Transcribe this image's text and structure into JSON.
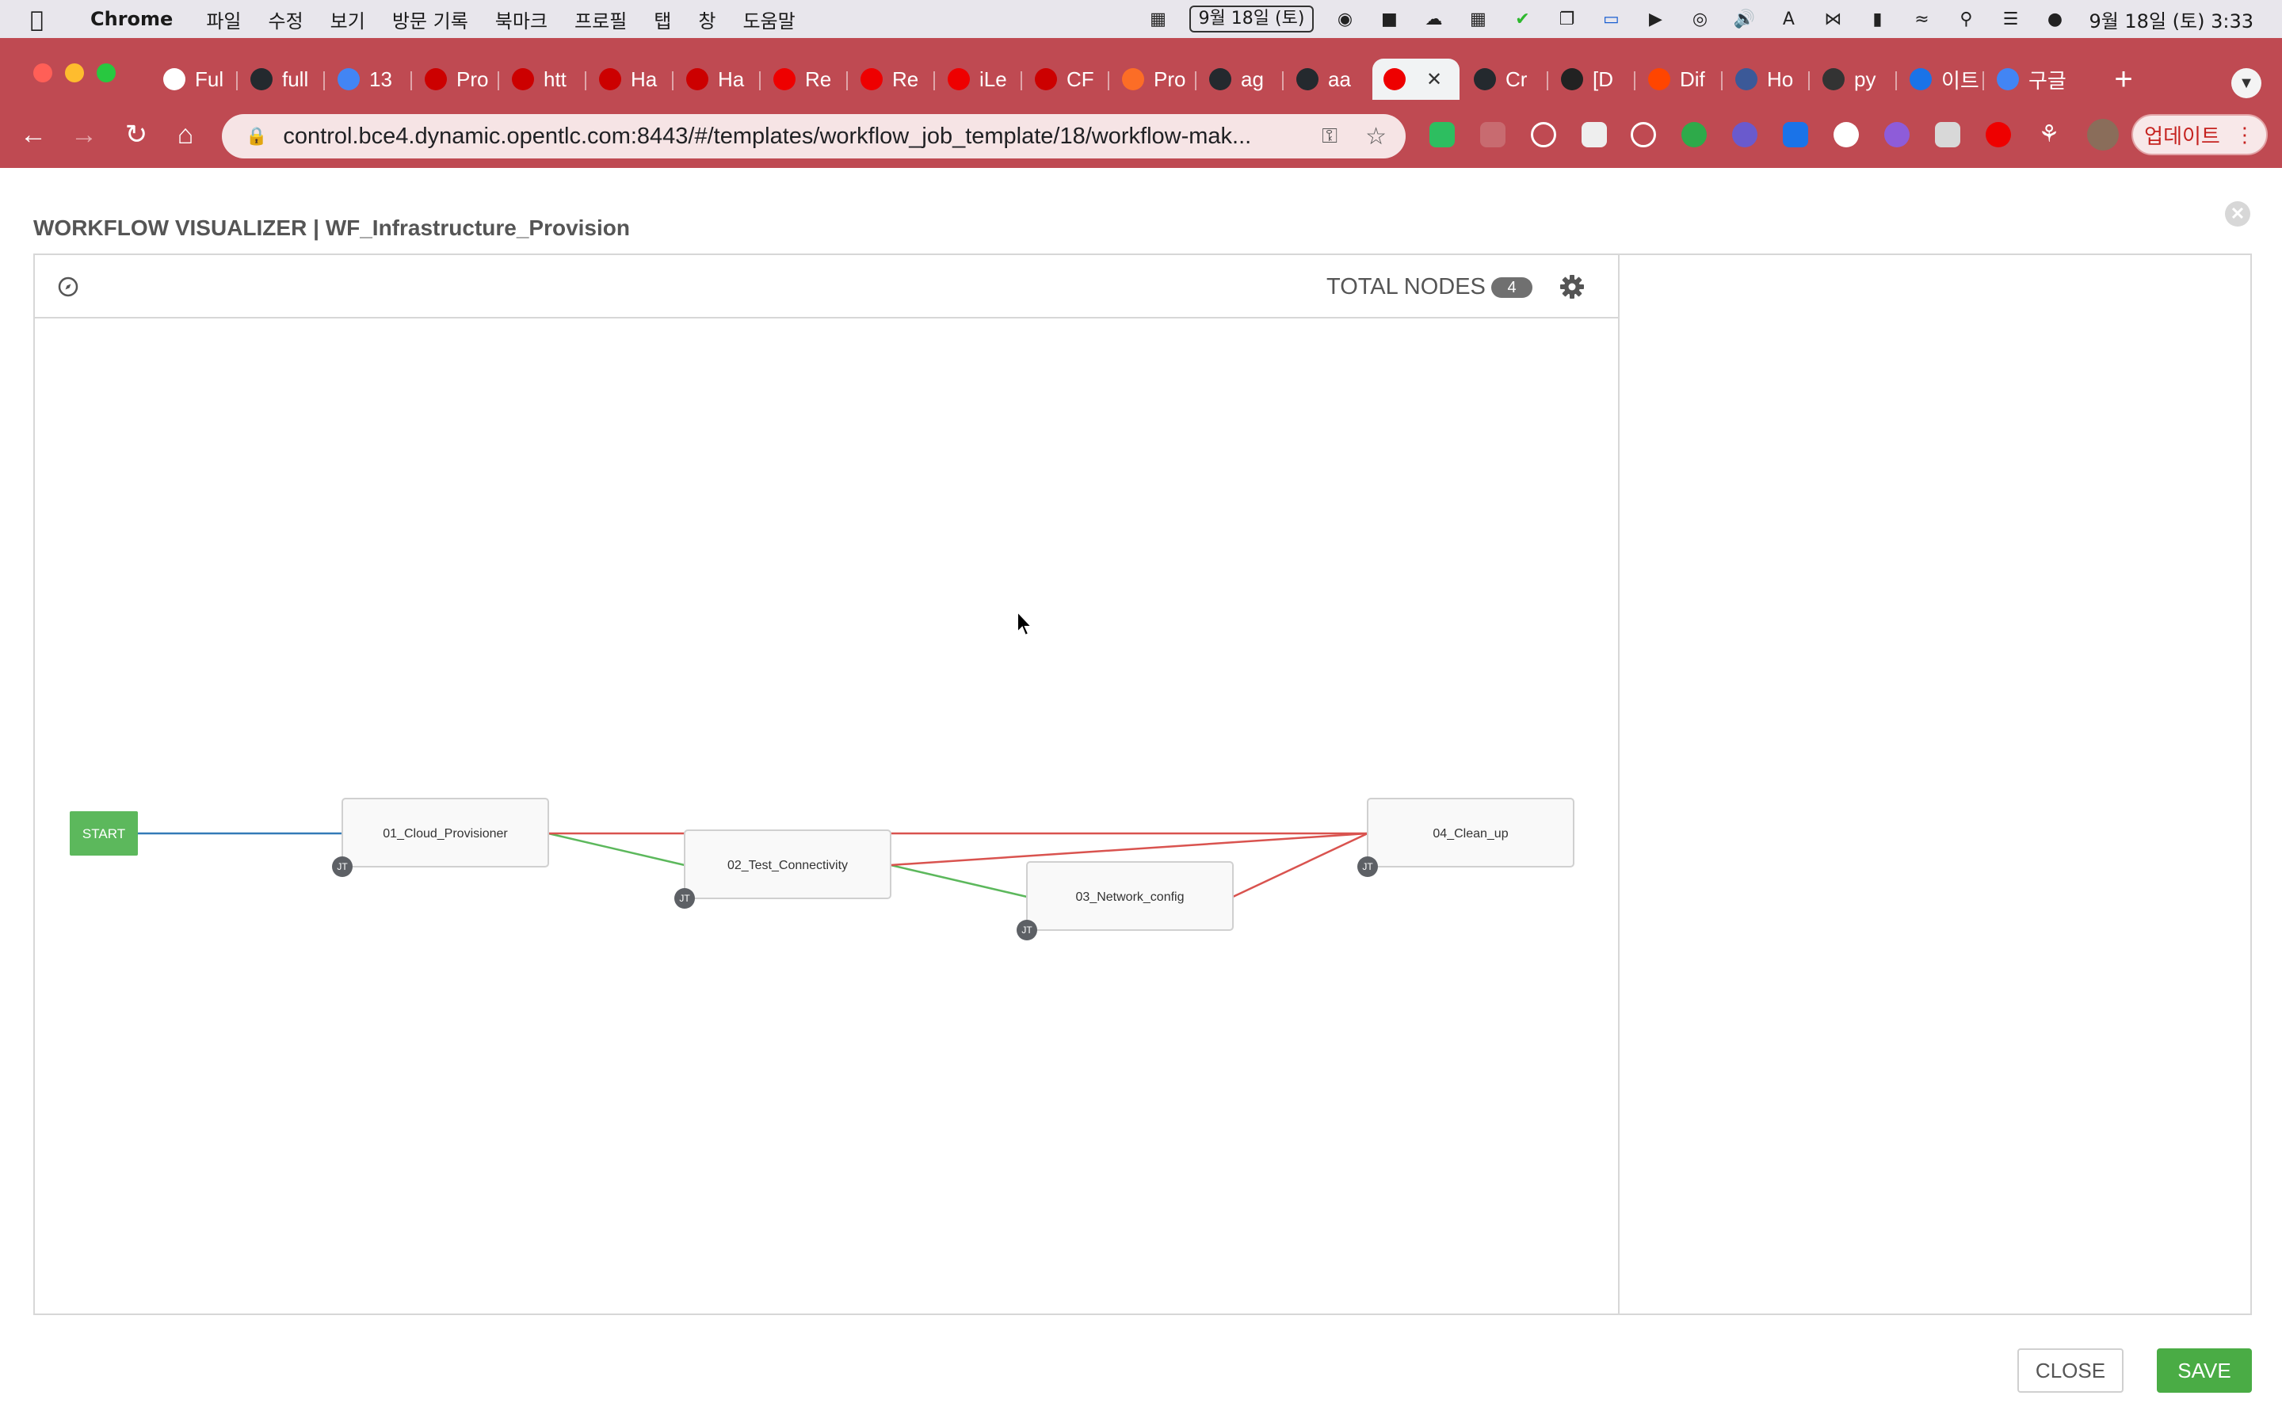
{
  "menubar": {
    "app_name": "Chrome",
    "menus": [
      "파일",
      "수정",
      "보기",
      "방문 기록",
      "북마크",
      "프로필",
      "탭",
      "창",
      "도움말"
    ],
    "date_badge": "9월 18일 (토)",
    "clock": "9월 18일 (토)  3:33"
  },
  "tabs": [
    {
      "label": "Ful",
      "icon": "udemy-icon",
      "color": "#ffffff"
    },
    {
      "label": "full",
      "icon": "github-icon",
      "color": "#24292e"
    },
    {
      "label": "13",
      "icon": "google-docs-icon",
      "color": "#4285f4"
    },
    {
      "label": "Pro",
      "icon": "redhat-icon",
      "color": "#cc0000"
    },
    {
      "label": "htt",
      "icon": "redhat-icon",
      "color": "#cc0000"
    },
    {
      "label": "Ha",
      "icon": "redhat-icon",
      "color": "#cc0000"
    },
    {
      "label": "Ha",
      "icon": "redhat-icon",
      "color": "#cc0000"
    },
    {
      "label": "Re",
      "icon": "redhat-hat-icon",
      "color": "#ee0000"
    },
    {
      "label": "Re",
      "icon": "redhat-hat-icon",
      "color": "#ee0000"
    },
    {
      "label": "iLe",
      "icon": "redhat-hat-icon",
      "color": "#ee0000"
    },
    {
      "label": "CF",
      "icon": "redhat-cf-icon",
      "color": "#cc0000"
    },
    {
      "label": "Pro",
      "icon": "gitlab-icon",
      "color": "#fc6d26"
    },
    {
      "label": "ag",
      "icon": "github-icon",
      "color": "#24292e"
    },
    {
      "label": "aa",
      "icon": "github-icon",
      "color": "#24292e"
    },
    {
      "label": "",
      "icon": "redhat-hat-icon",
      "color": "#ee0000",
      "active": true
    },
    {
      "label": "Cr",
      "icon": "github-icon",
      "color": "#24292e"
    },
    {
      "label": "[D",
      "icon": "trello-dots-icon",
      "color": "#222222"
    },
    {
      "label": "Dif",
      "icon": "reddit-icon",
      "color": "#ff4500"
    },
    {
      "label": "Ho",
      "icon": "info-icon",
      "color": "#3b5998"
    },
    {
      "label": "py",
      "icon": "search-icon",
      "color": "#333333"
    },
    {
      "label": "이트",
      "icon": "refresh-brand-icon",
      "color": "#1a73e8"
    },
    {
      "label": "구글",
      "icon": "google-icon",
      "color": "#4285f4"
    }
  ],
  "toolbar": {
    "url": "control.bce4.dynamic.opentlc.com:8443/#/templates/workflow_job_template/18/workflow-mak...",
    "update_label": "업데이트"
  },
  "modal": {
    "title": "WORKFLOW VISUALIZER | WF_Infrastructure_Provision",
    "total_nodes_label": "TOTAL NODES",
    "total_nodes": "4",
    "close_label": "CLOSE",
    "save_label": "SAVE"
  },
  "graph": {
    "start_label": "START",
    "start_color": "#5cb85c",
    "node_type_badge": "JT",
    "nodes": [
      {
        "id": "n1",
        "label": "01_Cloud_Provisioner"
      },
      {
        "id": "n2",
        "label": "02_Test_Connectivity"
      },
      {
        "id": "n3",
        "label": "03_Network_config"
      },
      {
        "id": "n4",
        "label": "04_Clean_up"
      }
    ],
    "edges": [
      {
        "from": "start",
        "to": "n1",
        "type": "always"
      },
      {
        "from": "n1",
        "to": "n2",
        "type": "success"
      },
      {
        "from": "n1",
        "to": "n4",
        "type": "failure"
      },
      {
        "from": "n2",
        "to": "n3",
        "type": "success"
      },
      {
        "from": "n2",
        "to": "n4",
        "type": "failure"
      },
      {
        "from": "n3",
        "to": "n4",
        "type": "failure"
      }
    ],
    "edge_colors": {
      "always": "#337ab7",
      "success": "#5cb85c",
      "failure": "#d9534f"
    }
  }
}
